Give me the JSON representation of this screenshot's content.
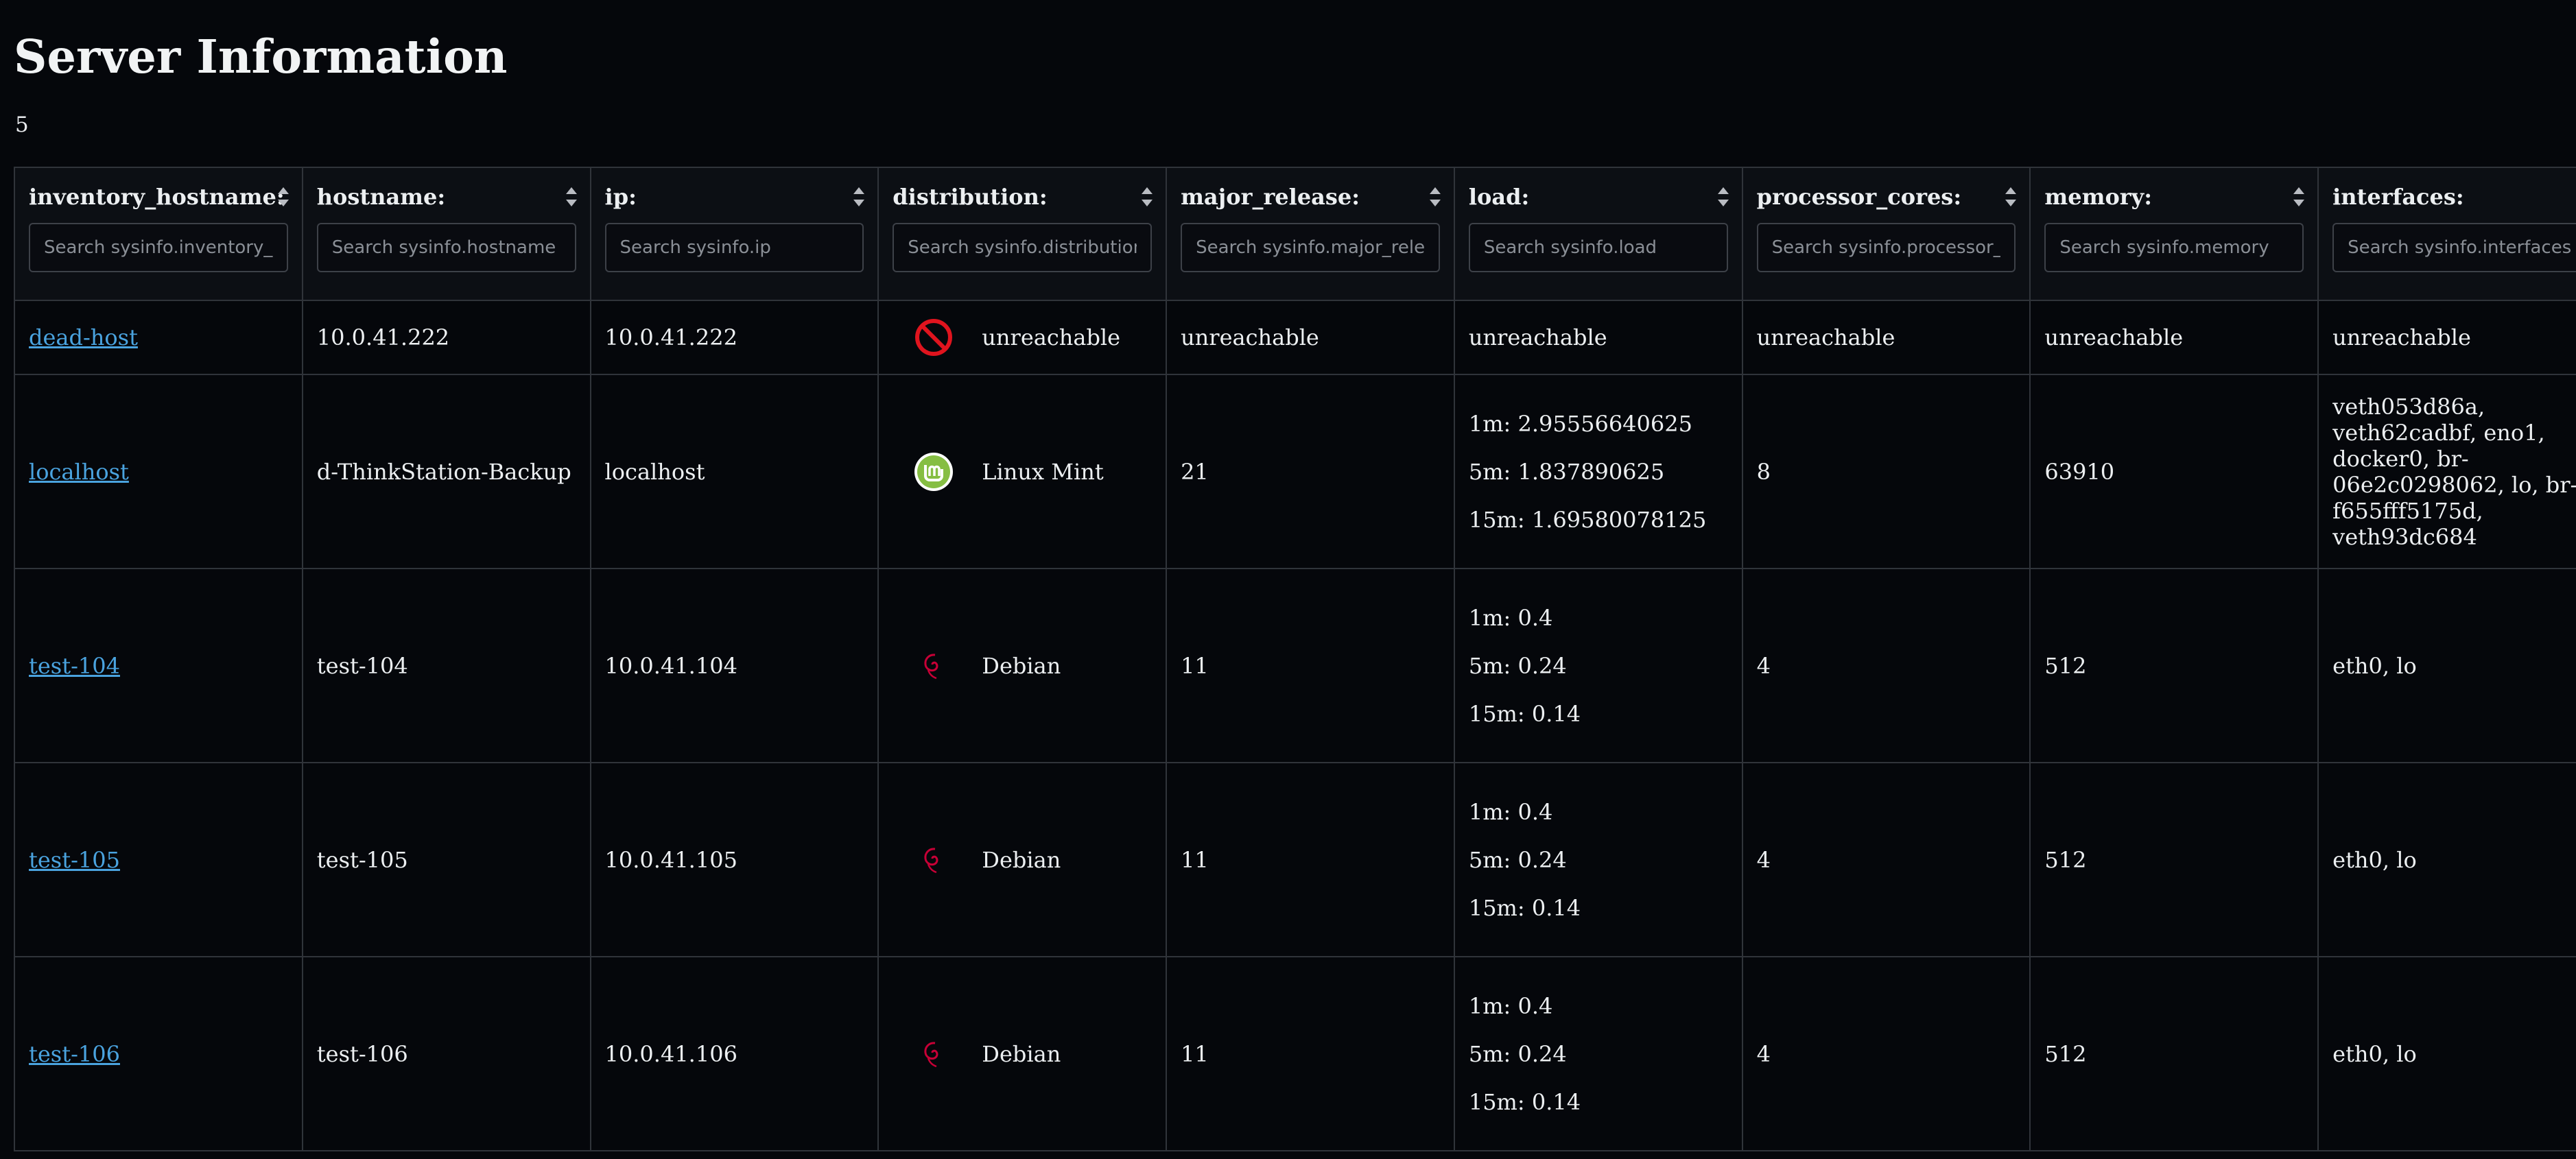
{
  "page": {
    "title": "Server Information",
    "host_count": "5"
  },
  "columns": [
    {
      "label": "inventory_hostname:",
      "placeholder": "Search sysinfo.inventory_hostname"
    },
    {
      "label": "hostname:",
      "placeholder": "Search sysinfo.hostname"
    },
    {
      "label": "ip:",
      "placeholder": "Search sysinfo.ip"
    },
    {
      "label": "distribution:",
      "placeholder": "Search sysinfo.distribution"
    },
    {
      "label": "major_release:",
      "placeholder": "Search sysinfo.major_release"
    },
    {
      "label": "load:",
      "placeholder": "Search sysinfo.load"
    },
    {
      "label": "processor_cores:",
      "placeholder": "Search sysinfo.processor_cores"
    },
    {
      "label": "memory:",
      "placeholder": "Search sysinfo.memory"
    },
    {
      "label": "interfaces:",
      "placeholder": "Search sysinfo.interfaces"
    }
  ],
  "rows": [
    {
      "inventory_hostname": "dead-host",
      "hostname": "10.0.41.222",
      "ip": "10.0.41.222",
      "distribution": "unreachable",
      "distribution_icon": "forbidden-icon",
      "major_release": "unreachable",
      "load_text": "unreachable",
      "processor_cores": "unreachable",
      "memory": "unreachable",
      "interfaces": "unreachable"
    },
    {
      "inventory_hostname": "localhost",
      "hostname": "d-ThinkStation-Backup",
      "ip": "localhost",
      "distribution": "Linux Mint",
      "distribution_icon": "linux-mint-icon",
      "major_release": "21",
      "load": [
        "1m: 2.95556640625",
        "5m: 1.837890625",
        "15m: 1.69580078125"
      ],
      "processor_cores": "8",
      "memory": "63910",
      "interfaces": "veth053d86a, veth62cadbf, eno1, docker0, br-06e2c0298062, lo, br-f655fff5175d, veth93dc684"
    },
    {
      "inventory_hostname": "test-104",
      "hostname": "test-104",
      "ip": "10.0.41.104",
      "distribution": "Debian",
      "distribution_icon": "debian-icon",
      "major_release": "11",
      "load": [
        "1m: 0.4",
        "5m: 0.24",
        "15m: 0.14"
      ],
      "processor_cores": "4",
      "memory": "512",
      "interfaces": "eth0, lo"
    },
    {
      "inventory_hostname": "test-105",
      "hostname": "test-105",
      "ip": "10.0.41.105",
      "distribution": "Debian",
      "distribution_icon": "debian-icon",
      "major_release": "11",
      "load": [
        "1m: 0.4",
        "5m: 0.24",
        "15m: 0.14"
      ],
      "processor_cores": "4",
      "memory": "512",
      "interfaces": "eth0, lo"
    },
    {
      "inventory_hostname": "test-106",
      "hostname": "test-106",
      "ip": "10.0.41.106",
      "distribution": "Debian",
      "distribution_icon": "debian-icon",
      "major_release": "11",
      "load": [
        "1m: 0.4",
        "5m: 0.24",
        "15m: 0.14"
      ],
      "processor_cores": "4",
      "memory": "512",
      "interfaces": "eth0, lo"
    }
  ],
  "colors": {
    "background": "#05070b",
    "link": "#4aa3df",
    "border": "#30343a",
    "forbidden_red": "#e0141e",
    "mint_green": "#86be43",
    "debian_red": "#c70036"
  }
}
